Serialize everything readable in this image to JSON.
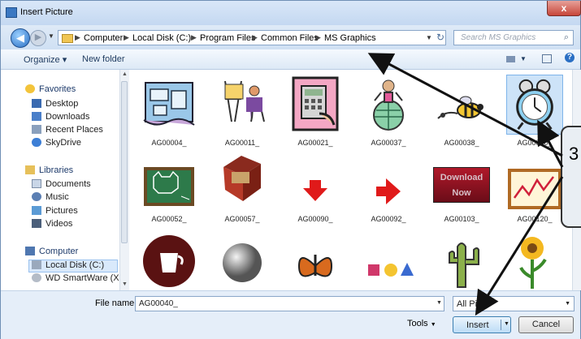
{
  "window": {
    "title": "Insert Picture",
    "close_label": "x"
  },
  "address": {
    "crumbs": [
      "Computer",
      "Local Disk (C:)",
      "Program Files",
      "Common Files",
      "MS Graphics"
    ],
    "search_placeholder": "Search MS Graphics"
  },
  "toolbar": {
    "organize_label": "Organize ▾",
    "new_folder_label": "New folder"
  },
  "sidebar": {
    "favorites": {
      "label": "Favorites",
      "items": [
        "Desktop",
        "Downloads",
        "Recent Places",
        "SkyDrive"
      ]
    },
    "libraries": {
      "label": "Libraries",
      "items": [
        "Documents",
        "Music",
        "Pictures",
        "Videos"
      ]
    },
    "computer": {
      "label": "Computer",
      "items": [
        "Local Disk (C:)",
        "WD SmartWare (X:)"
      ]
    }
  },
  "files": [
    {
      "name": "AG00004_",
      "icon": "map-icon"
    },
    {
      "name": "AG00011_",
      "icon": "artist-icon"
    },
    {
      "name": "AG00021_",
      "icon": "calculator-icon"
    },
    {
      "name": "AG00037_",
      "icon": "globe-icon"
    },
    {
      "name": "AG00038_",
      "icon": "bee-icon"
    },
    {
      "name": "AG00040_",
      "icon": "alarm-clock-icon",
      "selected": true
    },
    {
      "name": "AG00052_",
      "icon": "chalkboard-icon"
    },
    {
      "name": "AG00057_",
      "icon": "gift-box-icon"
    },
    {
      "name": "AG00090_",
      "icon": "down-arrow-icon"
    },
    {
      "name": "AG00092_",
      "icon": "right-arrow-icon"
    },
    {
      "name": "AG00103_",
      "icon": "download-now-icon",
      "caption": "Download Now"
    },
    {
      "name": "AG00120_",
      "icon": "chart-board-icon"
    },
    {
      "name": "",
      "icon": "coffee-cup-icon"
    },
    {
      "name": "",
      "icon": "sphere-icon"
    },
    {
      "name": "",
      "icon": "butterfly-icon"
    },
    {
      "name": "",
      "icon": "shapes-icon"
    },
    {
      "name": "",
      "icon": "cactus-icon"
    },
    {
      "name": "",
      "icon": "sunflower-icon"
    }
  ],
  "bottom": {
    "file_name_label": "File name:",
    "file_name_value": "AG00040_",
    "file_type_value": "All Pict",
    "tools_label": "Tools",
    "insert_label": "Insert",
    "cancel_label": "Cancel"
  },
  "annotation": {
    "number": "3"
  }
}
